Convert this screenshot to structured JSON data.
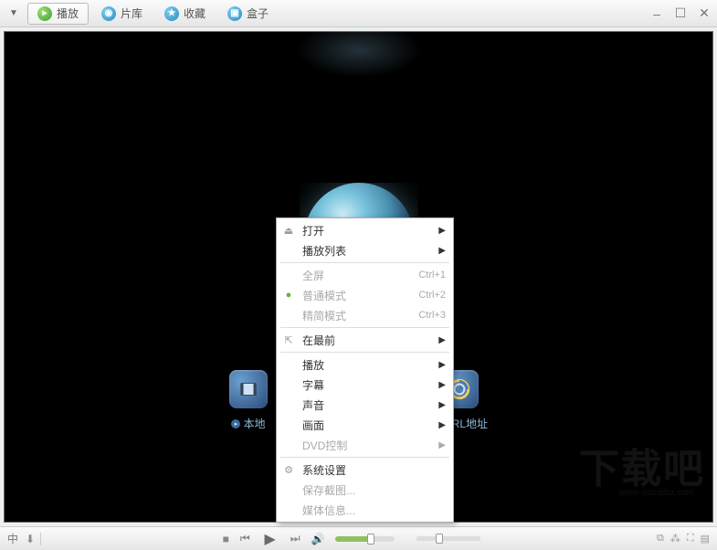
{
  "toolbar": {
    "tabs": [
      {
        "id": "play",
        "label": "播放"
      },
      {
        "id": "library",
        "label": "片库"
      },
      {
        "id": "favorites",
        "label": "收藏"
      },
      {
        "id": "box",
        "label": "盒子"
      }
    ]
  },
  "video": {
    "quicklinks": {
      "local": "本地",
      "url": "URL地址"
    }
  },
  "context_menu": {
    "items": [
      {
        "kind": "item",
        "label": "打开",
        "icon": "eject",
        "submenu": true,
        "enabled": true
      },
      {
        "kind": "item",
        "label": "播放列表",
        "submenu": true,
        "enabled": true
      },
      {
        "kind": "sep"
      },
      {
        "kind": "item",
        "label": "全屏",
        "shortcut": "Ctrl+1",
        "enabled": false
      },
      {
        "kind": "item",
        "label": "普通模式",
        "icon": "dot-green",
        "shortcut": "Ctrl+2",
        "enabled": false
      },
      {
        "kind": "item",
        "label": "精简模式",
        "shortcut": "Ctrl+3",
        "enabled": false
      },
      {
        "kind": "sep"
      },
      {
        "kind": "item",
        "label": "在最前",
        "icon": "pin",
        "submenu": true,
        "enabled": true
      },
      {
        "kind": "sep"
      },
      {
        "kind": "item",
        "label": "播放",
        "submenu": true,
        "enabled": true
      },
      {
        "kind": "item",
        "label": "字幕",
        "submenu": true,
        "enabled": true
      },
      {
        "kind": "item",
        "label": "声音",
        "submenu": true,
        "enabled": true
      },
      {
        "kind": "item",
        "label": "画面",
        "submenu": true,
        "enabled": true
      },
      {
        "kind": "item",
        "label": "DVD控制",
        "submenu": true,
        "enabled": false
      },
      {
        "kind": "sep"
      },
      {
        "kind": "item",
        "label": "系统设置",
        "icon": "gear",
        "enabled": true
      },
      {
        "kind": "item",
        "label": "保存截图...",
        "enabled": false
      },
      {
        "kind": "item",
        "label": "媒体信息...",
        "enabled": false
      }
    ]
  },
  "bottom": {
    "lang": "中",
    "volume_percent": 60,
    "progress_percent": 30
  },
  "watermark": {
    "main": "下载吧",
    "sub": "www.xiazaiba.com"
  }
}
